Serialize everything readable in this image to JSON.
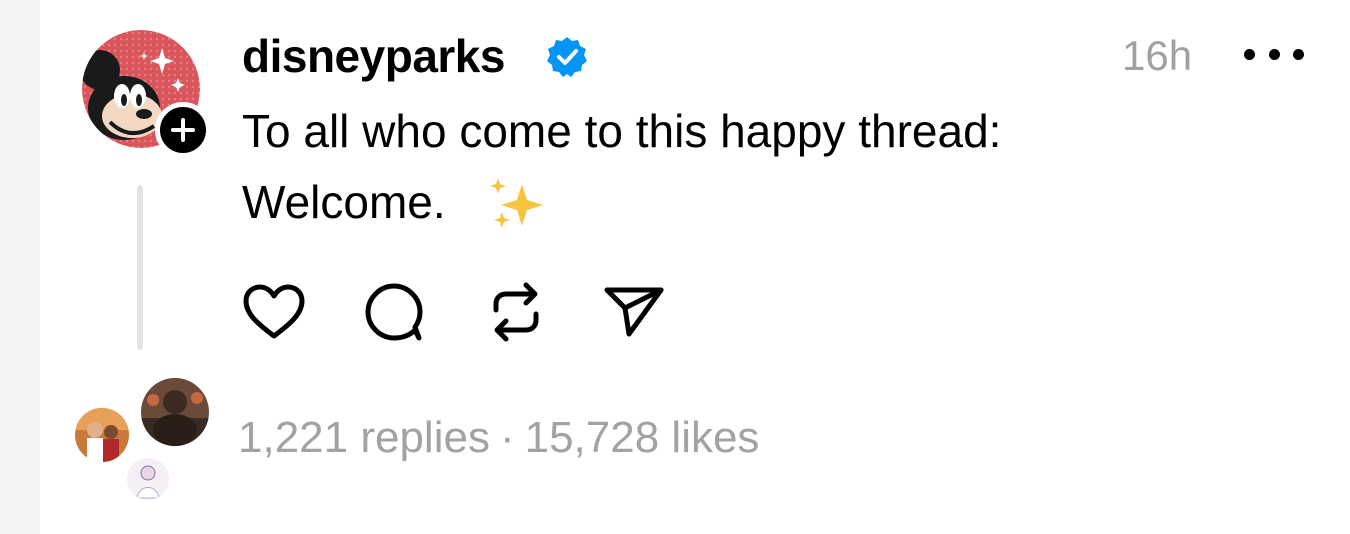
{
  "post": {
    "username": "disneyparks",
    "verified": true,
    "timestamp": "16h",
    "text_line1": "To all who come to this happy thread:",
    "text_line2": "Welcome.",
    "emoji": "sparkles"
  },
  "actions": [
    {
      "name": "like",
      "icon": "heart-icon"
    },
    {
      "name": "reply",
      "icon": "comment-icon"
    },
    {
      "name": "repost",
      "icon": "repost-icon"
    },
    {
      "name": "share",
      "icon": "send-icon"
    }
  ],
  "stats": {
    "replies": "1,221 replies",
    "separator": "·",
    "likes": "15,728 likes"
  },
  "colors": {
    "verified_blue": "#0095f6",
    "secondary_text": "#a0a0a0",
    "avatar_bg": "#d9555b",
    "sparkle_yellow": "#f5c542"
  }
}
